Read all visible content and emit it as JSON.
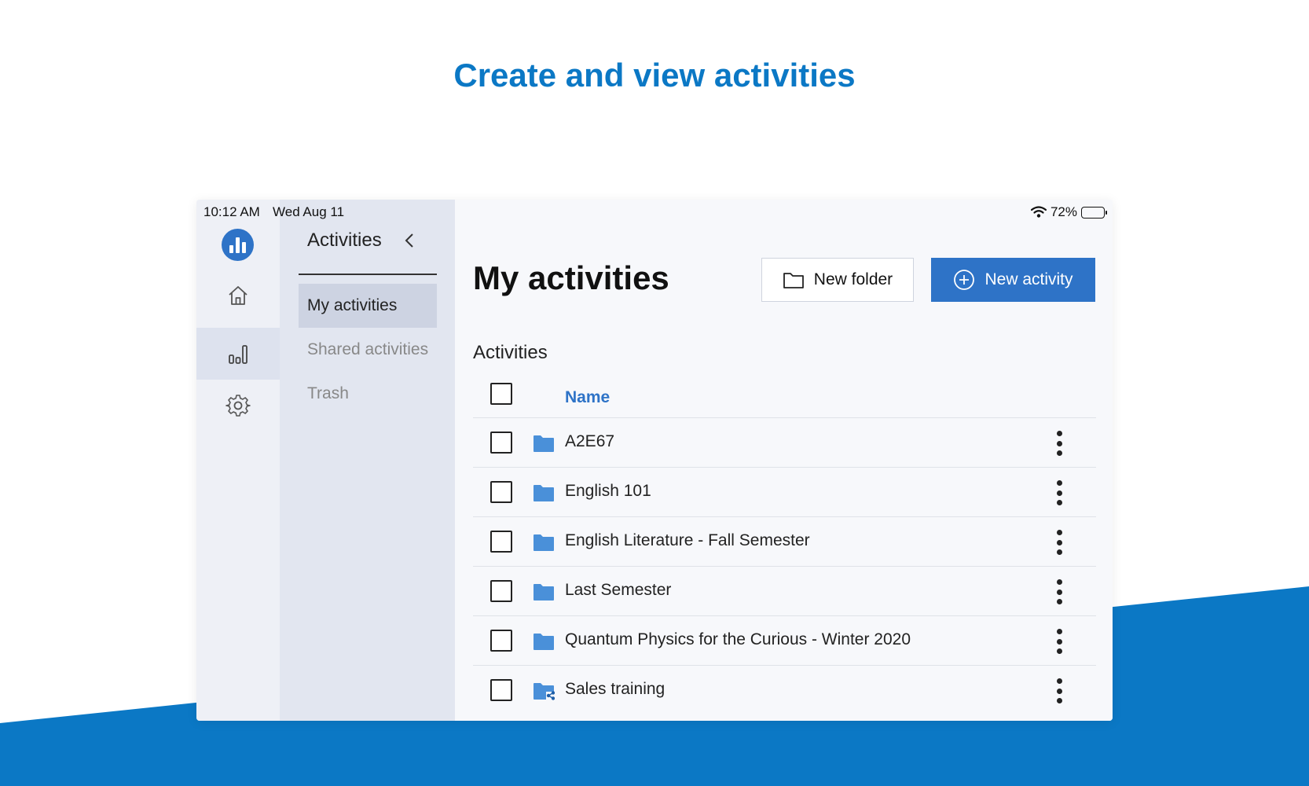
{
  "headline": "Create and view activities",
  "colors": {
    "brand": "#0b78c5",
    "accent": "#2e73c7",
    "folder": "#4a90d9"
  },
  "status_bar": {
    "time": "10:12 AM",
    "date": "Wed Aug 11",
    "battery": "72%",
    "battery_level": 0.72
  },
  "rail": {
    "items": [
      "logo-icon",
      "home-icon",
      "activities-icon",
      "settings-icon"
    ],
    "active": "activities-icon"
  },
  "panel": {
    "title": "Activities",
    "items": [
      {
        "label": "My activities",
        "active": true
      },
      {
        "label": "Shared activities",
        "active": false
      },
      {
        "label": "Trash",
        "active": false
      }
    ]
  },
  "main": {
    "title": "My activities",
    "new_folder_label": "New folder",
    "new_activity_label": "New activity",
    "section_title": "Activities",
    "column_name": "Name",
    "rows": [
      {
        "name": "A2E67",
        "icon": "folder-icon"
      },
      {
        "name": "English 101",
        "icon": "folder-icon"
      },
      {
        "name": "English Literature - Fall Semester",
        "icon": "folder-icon"
      },
      {
        "name": "Last Semester",
        "icon": "folder-icon"
      },
      {
        "name": "Quantum Physics for the Curious - Winter 2020",
        "icon": "folder-icon"
      },
      {
        "name": "Sales training",
        "icon": "shared-folder-icon"
      }
    ]
  }
}
